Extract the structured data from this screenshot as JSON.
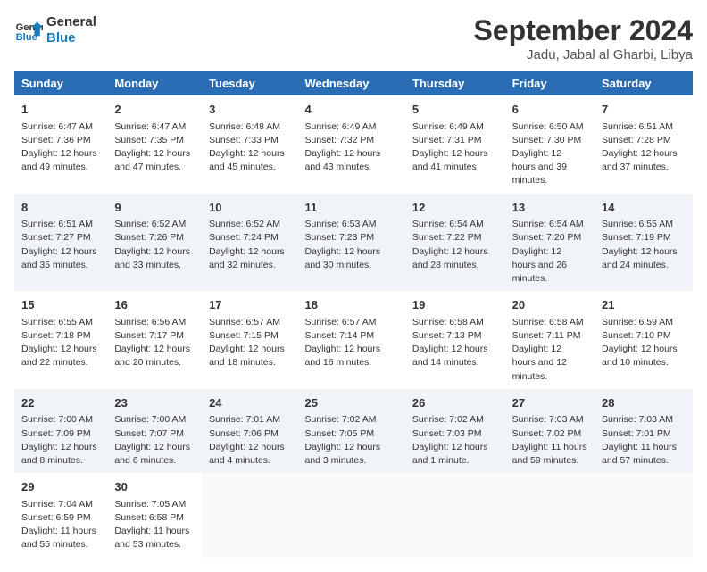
{
  "logo": {
    "text_general": "General",
    "text_blue": "Blue"
  },
  "title": "September 2024",
  "subtitle": "Jadu, Jabal al Gharbi, Libya",
  "days_header": [
    "Sunday",
    "Monday",
    "Tuesday",
    "Wednesday",
    "Thursday",
    "Friday",
    "Saturday"
  ],
  "weeks": [
    [
      {
        "day": "1",
        "sunrise": "6:47 AM",
        "sunset": "7:36 PM",
        "daylight": "12 hours and 49 minutes."
      },
      {
        "day": "2",
        "sunrise": "6:47 AM",
        "sunset": "7:35 PM",
        "daylight": "12 hours and 47 minutes."
      },
      {
        "day": "3",
        "sunrise": "6:48 AM",
        "sunset": "7:33 PM",
        "daylight": "12 hours and 45 minutes."
      },
      {
        "day": "4",
        "sunrise": "6:49 AM",
        "sunset": "7:32 PM",
        "daylight": "12 hours and 43 minutes."
      },
      {
        "day": "5",
        "sunrise": "6:49 AM",
        "sunset": "7:31 PM",
        "daylight": "12 hours and 41 minutes."
      },
      {
        "day": "6",
        "sunrise": "6:50 AM",
        "sunset": "7:30 PM",
        "daylight": "12 hours and 39 minutes."
      },
      {
        "day": "7",
        "sunrise": "6:51 AM",
        "sunset": "7:28 PM",
        "daylight": "12 hours and 37 minutes."
      }
    ],
    [
      {
        "day": "8",
        "sunrise": "6:51 AM",
        "sunset": "7:27 PM",
        "daylight": "12 hours and 35 minutes."
      },
      {
        "day": "9",
        "sunrise": "6:52 AM",
        "sunset": "7:26 PM",
        "daylight": "12 hours and 33 minutes."
      },
      {
        "day": "10",
        "sunrise": "6:52 AM",
        "sunset": "7:24 PM",
        "daylight": "12 hours and 32 minutes."
      },
      {
        "day": "11",
        "sunrise": "6:53 AM",
        "sunset": "7:23 PM",
        "daylight": "12 hours and 30 minutes."
      },
      {
        "day": "12",
        "sunrise": "6:54 AM",
        "sunset": "7:22 PM",
        "daylight": "12 hours and 28 minutes."
      },
      {
        "day": "13",
        "sunrise": "6:54 AM",
        "sunset": "7:20 PM",
        "daylight": "12 hours and 26 minutes."
      },
      {
        "day": "14",
        "sunrise": "6:55 AM",
        "sunset": "7:19 PM",
        "daylight": "12 hours and 24 minutes."
      }
    ],
    [
      {
        "day": "15",
        "sunrise": "6:55 AM",
        "sunset": "7:18 PM",
        "daylight": "12 hours and 22 minutes."
      },
      {
        "day": "16",
        "sunrise": "6:56 AM",
        "sunset": "7:17 PM",
        "daylight": "12 hours and 20 minutes."
      },
      {
        "day": "17",
        "sunrise": "6:57 AM",
        "sunset": "7:15 PM",
        "daylight": "12 hours and 18 minutes."
      },
      {
        "day": "18",
        "sunrise": "6:57 AM",
        "sunset": "7:14 PM",
        "daylight": "12 hours and 16 minutes."
      },
      {
        "day": "19",
        "sunrise": "6:58 AM",
        "sunset": "7:13 PM",
        "daylight": "12 hours and 14 minutes."
      },
      {
        "day": "20",
        "sunrise": "6:58 AM",
        "sunset": "7:11 PM",
        "daylight": "12 hours and 12 minutes."
      },
      {
        "day": "21",
        "sunrise": "6:59 AM",
        "sunset": "7:10 PM",
        "daylight": "12 hours and 10 minutes."
      }
    ],
    [
      {
        "day": "22",
        "sunrise": "7:00 AM",
        "sunset": "7:09 PM",
        "daylight": "12 hours and 8 minutes."
      },
      {
        "day": "23",
        "sunrise": "7:00 AM",
        "sunset": "7:07 PM",
        "daylight": "12 hours and 6 minutes."
      },
      {
        "day": "24",
        "sunrise": "7:01 AM",
        "sunset": "7:06 PM",
        "daylight": "12 hours and 4 minutes."
      },
      {
        "day": "25",
        "sunrise": "7:02 AM",
        "sunset": "7:05 PM",
        "daylight": "12 hours and 3 minutes."
      },
      {
        "day": "26",
        "sunrise": "7:02 AM",
        "sunset": "7:03 PM",
        "daylight": "12 hours and 1 minute."
      },
      {
        "day": "27",
        "sunrise": "7:03 AM",
        "sunset": "7:02 PM",
        "daylight": "11 hours and 59 minutes."
      },
      {
        "day": "28",
        "sunrise": "7:03 AM",
        "sunset": "7:01 PM",
        "daylight": "11 hours and 57 minutes."
      }
    ],
    [
      {
        "day": "29",
        "sunrise": "7:04 AM",
        "sunset": "6:59 PM",
        "daylight": "11 hours and 55 minutes."
      },
      {
        "day": "30",
        "sunrise": "7:05 AM",
        "sunset": "6:58 PM",
        "daylight": "11 hours and 53 minutes."
      },
      null,
      null,
      null,
      null,
      null
    ]
  ]
}
